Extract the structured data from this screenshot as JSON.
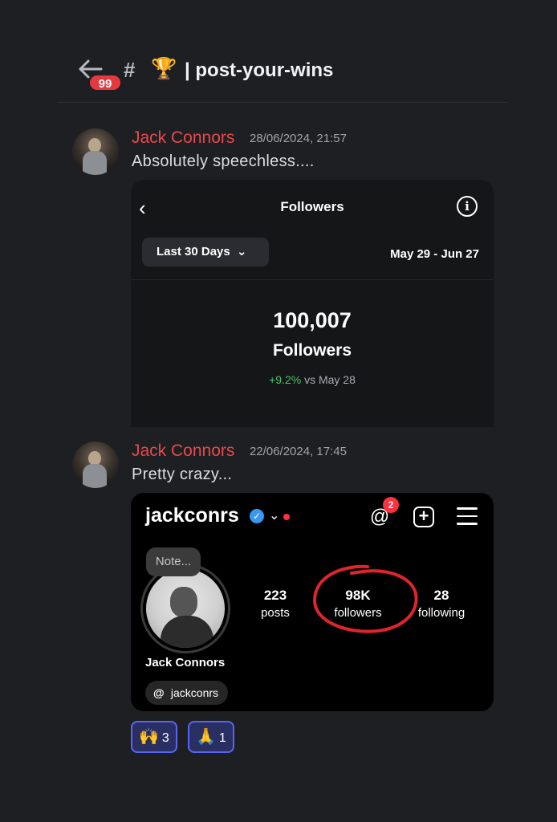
{
  "header": {
    "unread_badge": "99",
    "channel_hash": "#",
    "channel_emoji": "🏆",
    "channel_name": "| post-your-wins"
  },
  "messages": [
    {
      "author": "Jack Connors",
      "timestamp": "28/06/2024, 21:57",
      "text": "Absolutely speechless...."
    },
    {
      "author": "Jack Connors",
      "timestamp": "22/06/2024, 17:45",
      "text": "Pretty crazy..."
    }
  ],
  "followers_card": {
    "back_icon": "‹",
    "title": "Followers",
    "info_icon": "i",
    "filter_label": "Last 30 Days",
    "filter_chevron": "⌄",
    "date_range": "May 29 - Jun 27",
    "count": "100,007",
    "count_label": "Followers",
    "delta": "+9.2%",
    "delta_suffix": " vs May 28"
  },
  "profile_card": {
    "username": "jackconrs",
    "verified_glyph": "✓",
    "chevron": "⌄",
    "threads_glyph": "@",
    "threads_badge": "2",
    "plus_glyph": "+",
    "note": "Note...",
    "stats": [
      {
        "number": "223",
        "label": "posts"
      },
      {
        "number": "98K",
        "label": "followers"
      },
      {
        "number": "28",
        "label": "following"
      }
    ],
    "display_name": "Jack Connors",
    "threads_handle": "jackconrs",
    "threads_handle_glyph": "@"
  },
  "reactions": [
    {
      "emoji": "🙌",
      "count": "3"
    },
    {
      "emoji": "🙏",
      "count": "1"
    }
  ],
  "colors": {
    "background": "#1e1f22",
    "author": "#e8494d",
    "badge": "#e5393f",
    "positive": "#4cc26a",
    "annotation_circle": "#e0242c",
    "reaction_border": "#5865f2"
  }
}
